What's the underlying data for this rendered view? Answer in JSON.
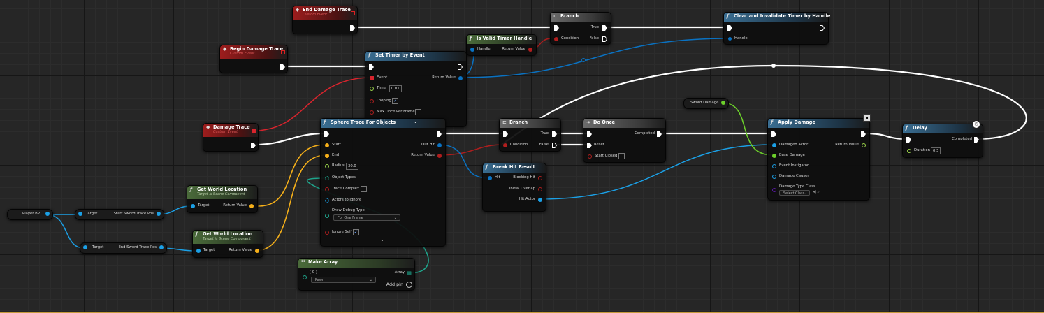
{
  "colors": {
    "exec": "#ffffff",
    "object": "#1ba0e6",
    "vector": "#f6b01a",
    "float": "#9bd54a",
    "bool": "#b01e1e",
    "struct": "#0a72c2",
    "array": "#1fa58c",
    "class": "#5a18a8"
  },
  "nodes": {
    "end_damage_trace": {
      "title": "End Damage Trace",
      "subtitle": "Custom Event"
    },
    "begin_damage_trace": {
      "title": "Begin Damage Trace",
      "subtitle": "Custom Event"
    },
    "damage_trace": {
      "title": "Damage Trace",
      "subtitle": "Custom Event"
    },
    "branch_top": {
      "title": "Branch",
      "pins": {
        "condition": "Condition",
        "true": "True",
        "false": "False"
      }
    },
    "is_valid_timer": {
      "title": "Is Valid Timer Handle",
      "pins": {
        "handle": "Handle",
        "return": "Return Value"
      }
    },
    "clear_invalidate": {
      "title": "Clear and Invalidate Timer by Handle",
      "pins": {
        "handle": "Handle"
      }
    },
    "set_timer": {
      "title": "Set Timer by Event",
      "pins": {
        "event": "Event",
        "time": "Time",
        "time_value": "0.01",
        "looping": "Looping",
        "max_once": "Max Once Per Frame",
        "return": "Return Value"
      }
    },
    "sphere_trace": {
      "title": "Sphere Trace For Objects",
      "pins": {
        "start": "Start",
        "end": "End",
        "radius": "Radius",
        "radius_value": "30.0",
        "object_types": "Object Types",
        "trace_complex": "Trace Complex",
        "actors_ignore": "Actors to Ignore",
        "draw_debug": "Draw Debug Type",
        "draw_debug_value": "For One Frame",
        "ignore_self": "Ignore Self",
        "out_hit": "Out Hit",
        "return": "Return Value"
      }
    },
    "branch_mid": {
      "title": "Branch",
      "pins": {
        "condition": "Condition",
        "true": "True",
        "false": "False"
      }
    },
    "do_once": {
      "title": "Do Once",
      "pins": {
        "reset": "Reset",
        "start_closed": "Start Closed",
        "completed": "Completed"
      }
    },
    "break_hit": {
      "title": "Break Hit Result",
      "pins": {
        "hit": "Hit",
        "blocking": "Blocking Hit",
        "initial": "Initial Overlap",
        "hit_actor": "Hit Actor"
      }
    },
    "apply_damage": {
      "title": "Apply Damage",
      "pins": {
        "damaged_actor": "Damaged Actor",
        "base_damage": "Base Damage",
        "instigator": "Event Instigator",
        "causer": "Damage Causer",
        "type_class": "Damage Type Class",
        "select_class": "Select Class",
        "return": "Return Value"
      }
    },
    "delay": {
      "title": "Delay",
      "pins": {
        "duration": "Duration",
        "duration_value": "0.3",
        "completed": "Completed"
      }
    },
    "sword_damage": {
      "label": "Sword Damage"
    },
    "player_bp": {
      "label": "Player BP"
    },
    "start_sword": {
      "target": "Target",
      "label": "Start Sword Trace Pos"
    },
    "end_sword": {
      "target": "Target",
      "label": "End Sword Trace Pos"
    },
    "gwl1": {
      "title": "Get World Location",
      "subtitle": "Target is Scene Component",
      "pins": {
        "target": "Target",
        "return": "Return Value"
      }
    },
    "gwl2": {
      "title": "Get World Location",
      "subtitle": "Target is Scene Component",
      "pins": {
        "target": "Target",
        "return": "Return Value"
      }
    },
    "make_array": {
      "title": "Make Array",
      "pins": {
        "index": "[ 0 ]",
        "value": "Pawn",
        "array": "Array",
        "add_pin": "Add pin"
      }
    }
  }
}
